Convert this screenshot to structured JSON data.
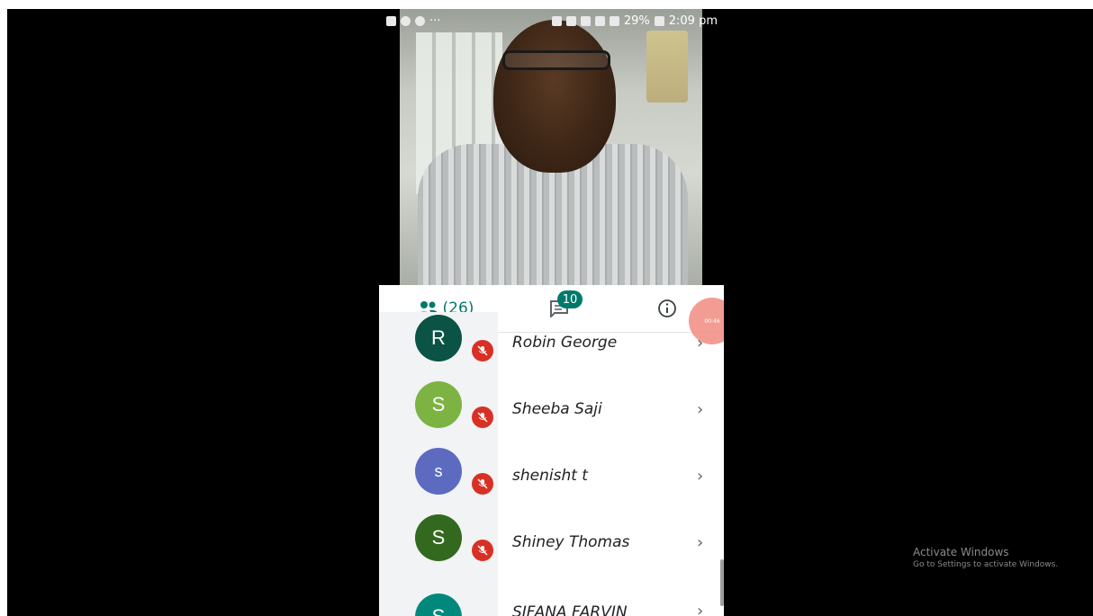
{
  "status_bar": {
    "left_icons": [
      "camera-icon",
      "location-icon",
      "sync-icon"
    ],
    "more": "···",
    "battery": "29%",
    "time": "2:09 pm"
  },
  "tabs": {
    "people_count": "(26)",
    "chat_badge": "10",
    "recording_time": "00:46"
  },
  "participants": [
    {
      "initial": "R",
      "name": "Robin George",
      "color": "#0b5345"
    },
    {
      "initial": "S",
      "name": "Sheeba Saji",
      "color": "#7cb342"
    },
    {
      "initial": "s",
      "name": "shenisht t",
      "color": "#5c6bc0"
    },
    {
      "initial": "S",
      "name": "Shiney Thomas",
      "color": "#33691e"
    },
    {
      "initial": "S",
      "name": "SIFANA FARVIN",
      "color": "#00897b"
    }
  ],
  "watermark": {
    "title": "Activate Windows",
    "subtitle": "Go to Settings to activate Windows."
  }
}
